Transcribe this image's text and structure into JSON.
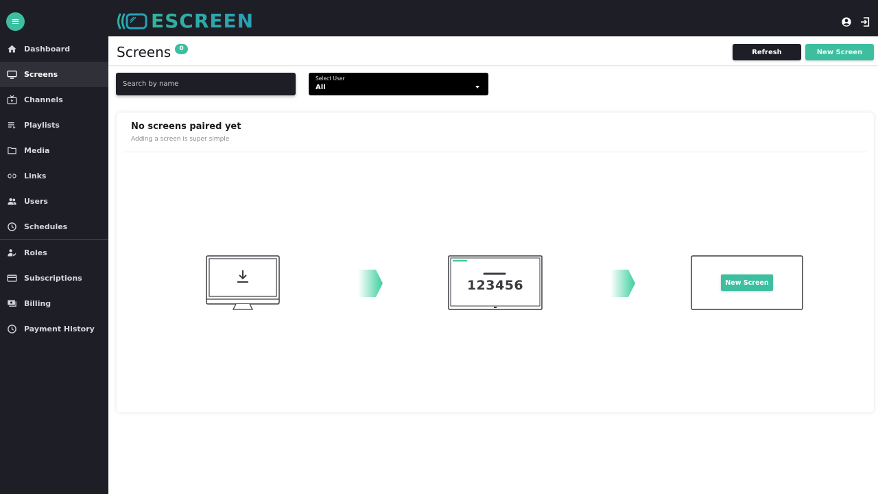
{
  "app": {
    "logo_text": "ESCREEN",
    "colors": {
      "accent": "#3dbf9f",
      "dark": "#1e1f26",
      "sidebar_active": "#2f3038"
    }
  },
  "topbar": {
    "menu_icon": "hamburger-icon",
    "account_icon": "account-circle-icon",
    "logout_icon": "logout-icon"
  },
  "sidebar": {
    "items": [
      {
        "label": "Dashboard",
        "icon": "home-icon",
        "active": false
      },
      {
        "label": "Screens",
        "icon": "monitor-icon",
        "active": true
      },
      {
        "label": "Channels",
        "icon": "tv-play-icon",
        "active": false
      },
      {
        "label": "Playlists",
        "icon": "playlist-icon",
        "active": false
      },
      {
        "label": "Media",
        "icon": "folder-icon",
        "active": false
      },
      {
        "label": "Links",
        "icon": "link-icon",
        "active": false
      },
      {
        "label": "Users",
        "icon": "users-icon",
        "active": false
      },
      {
        "label": "Schedules",
        "icon": "clock-icon",
        "active": false
      },
      {
        "label": "Roles",
        "icon": "user-check-icon",
        "active": false
      },
      {
        "label": "Subscriptions",
        "icon": "card-icon",
        "active": false
      },
      {
        "label": "Billing",
        "icon": "bills-icon",
        "active": false
      },
      {
        "label": "Payment History",
        "icon": "clock-icon",
        "active": false
      }
    ]
  },
  "header": {
    "title": "Screens",
    "count": "0",
    "refresh_label": "Refresh",
    "new_screen_label": "New Screen"
  },
  "filters": {
    "search_placeholder": "Search by name",
    "select_label": "Select User",
    "select_value": "All"
  },
  "empty_state": {
    "title": "No screens paired yet",
    "subtitle": "Adding a screen is super simple",
    "step2_code": "123456",
    "step3_button": "New Screen"
  }
}
